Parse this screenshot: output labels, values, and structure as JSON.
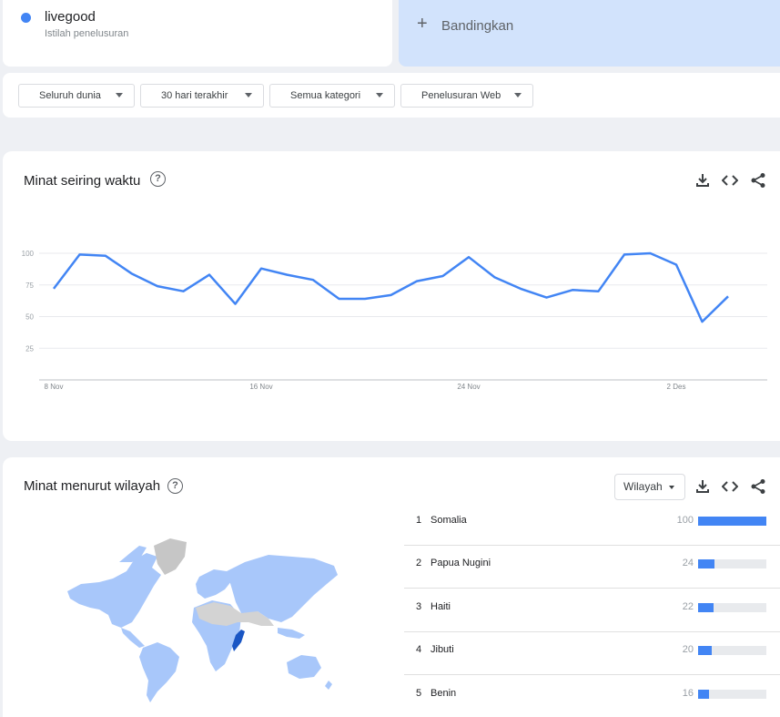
{
  "term": {
    "name": "livegood",
    "subtitle": "Istilah penelusuran",
    "color": "#4285f4"
  },
  "compare": {
    "plus": "+",
    "label": "Bandingkan"
  },
  "filters": [
    {
      "label": "Seluruh dunia"
    },
    {
      "label": "30 hari terakhir"
    },
    {
      "label": "Semua kategori"
    },
    {
      "label": "Penelusuran Web"
    }
  ],
  "time_card": {
    "title": "Minat seiring waktu",
    "help": "?",
    "icons": [
      "download-icon",
      "embed-icon",
      "share-icon"
    ]
  },
  "chart_data": {
    "type": "line",
    "x": [
      "8 Nov",
      "9 Nov",
      "10 Nov",
      "11 Nov",
      "12 Nov",
      "13 Nov",
      "14 Nov",
      "15 Nov",
      "16 Nov",
      "17 Nov",
      "18 Nov",
      "19 Nov",
      "20 Nov",
      "21 Nov",
      "22 Nov",
      "23 Nov",
      "24 Nov",
      "25 Nov",
      "26 Nov",
      "27 Nov",
      "28 Nov",
      "29 Nov",
      "30 Nov",
      "1 Des",
      "2 Des",
      "3 Des",
      "4 Des"
    ],
    "series": [
      {
        "values": [
          72,
          99,
          98,
          84,
          74,
          70,
          83,
          60,
          88,
          83,
          79,
          64,
          64,
          67,
          78,
          82,
          97,
          81,
          72,
          65,
          71,
          70,
          99,
          100,
          91,
          46,
          66
        ],
        "color": "#4285f4"
      }
    ],
    "x_tick_labels": [
      "8 Nov",
      "16 Nov",
      "24 Nov",
      "2 Des"
    ],
    "y_tick_labels": [
      "100",
      "75",
      "50",
      "25"
    ],
    "ylim": [
      0,
      100
    ],
    "grid": true,
    "title": "",
    "xlabel": "",
    "ylabel": ""
  },
  "region_card": {
    "title": "Minat menurut wilayah",
    "help": "?",
    "select_label": "Wilayah",
    "icons": [
      "download-icon",
      "embed-icon",
      "share-icon"
    ],
    "map_color": "#a8c7fa",
    "map_highlight": "#1a56c4",
    "rows": [
      {
        "rank": "1",
        "name": "Somalia",
        "value": "100",
        "fill": 100
      },
      {
        "rank": "2",
        "name": "Papua Nugini",
        "value": "24",
        "fill": 24
      },
      {
        "rank": "3",
        "name": "Haiti",
        "value": "22",
        "fill": 22
      },
      {
        "rank": "4",
        "name": "Jibuti",
        "value": "20",
        "fill": 20
      },
      {
        "rank": "5",
        "name": "Benin",
        "value": "16",
        "fill": 16
      }
    ]
  }
}
